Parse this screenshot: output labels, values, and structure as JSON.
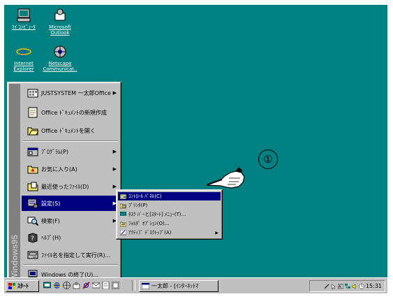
{
  "desktop": {
    "icons": [
      {
        "label": "ﾏｲ ｺﾝﾋﾟｭｰﾀ",
        "icon": "my-computer-icon"
      },
      {
        "label": "Microsoft Outlook",
        "icon": "outlook-icon"
      },
      {
        "label": "Internet Explorer",
        "icon": "internet-explorer-icon"
      },
      {
        "label": "Netscape Communicat..",
        "icon": "netscape-icon"
      }
    ]
  },
  "start_menu": {
    "banner": "Windows95",
    "items": [
      {
        "label": "JUSTSYSTEM 一太郎Office",
        "icon": "justsystem-folder-icon",
        "submenu": true
      },
      {
        "label": "Office ﾄﾞｷｭﾒﾝﾄの新規作成",
        "icon": "new-office-doc-icon",
        "submenu": false
      },
      {
        "label": "Office ﾄﾞｷｭﾒﾝﾄを開く",
        "icon": "open-office-doc-icon",
        "submenu": false
      },
      {
        "label": "ﾌﾟﾛｸﾞﾗﾑ(P)",
        "icon": "programs-icon",
        "submenu": true
      },
      {
        "label": "お気に入り(A)",
        "icon": "favorites-icon",
        "submenu": true
      },
      {
        "label": "最近使ったﾌｧｲﾙ(D)",
        "icon": "documents-icon",
        "submenu": true
      },
      {
        "label": "設定(S)",
        "icon": "settings-icon",
        "submenu": true
      },
      {
        "label": "検索(F)",
        "icon": "find-icon",
        "submenu": true
      },
      {
        "label": "ﾍﾙﾌﾟ(H)",
        "icon": "help-icon",
        "submenu": false
      },
      {
        "label": "ﾌｧｲﾙ名を指定して実行(R)...",
        "icon": "run-icon",
        "submenu": false
      },
      {
        "label": "Windows の終了(U)...",
        "icon": "shutdown-icon",
        "submenu": false
      }
    ]
  },
  "settings_submenu": {
    "items": [
      {
        "label": "ｺﾝﾄﾛｰﾙ ﾊﾟﾈﾙ(C)",
        "icon": "control-panel-icon"
      },
      {
        "label": "ﾌﾟﾘﾝﾀ(P)",
        "icon": "printers-icon"
      },
      {
        "label": "ﾀｽｸ ﾊﾞｰと[ｽﾀｰﾄ] ﾒﾆｭｰ(T)...",
        "icon": "taskbar-icon"
      },
      {
        "label": "ﾌｫﾙﾀﾞ ｵﾌﾟｼｮﾝ(O)...",
        "icon": "folder-options-icon"
      },
      {
        "label": "ｱｸﾃｨﾌﾞ ﾃﾞｽｸﾄｯﾌﾟ(A)",
        "icon": "active-desktop-icon"
      }
    ]
  },
  "annotation": {
    "number": "①"
  },
  "taskbar": {
    "start_label": "ｽﾀｰﾄ",
    "task_label": "一太郎 - [ｲﾝﾀｰﾈｯﾄﾏ",
    "clock": "15:31"
  },
  "colors": {
    "desktop": "#008080",
    "highlight": "#000080",
    "face": "#c0c0c0"
  }
}
